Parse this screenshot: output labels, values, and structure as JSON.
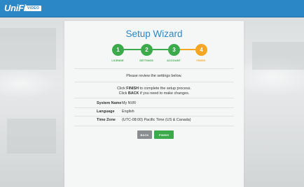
{
  "header": {
    "logo_text": "UniFi",
    "logo_badge": "VIDEO",
    "brand_color": "#2b87c6"
  },
  "wizard": {
    "title": "Setup Wizard",
    "steps": [
      {
        "number": "1",
        "label": "LICENSE",
        "state": "complete",
        "color": "#3aaa4a"
      },
      {
        "number": "2",
        "label": "SETTINGS",
        "state": "complete",
        "color": "#3aaa4a"
      },
      {
        "number": "3",
        "label": "ACCOUNT",
        "state": "complete",
        "color": "#3aaa4a"
      },
      {
        "number": "4",
        "label": "FINISH",
        "state": "current",
        "color": "#f5a623"
      }
    ],
    "review_text": "Please review the settings below.",
    "instruction_line1_pre": "Click ",
    "instruction_line1_bold": "FINISH",
    "instruction_line1_post": " to complete the setup process.",
    "instruction_line2_pre": "Click ",
    "instruction_line2_bold": "BACK",
    "instruction_line2_post": " if you need to make changes.",
    "settings": [
      {
        "label": "System Name",
        "value": "My NVR"
      },
      {
        "label": "Language",
        "value": "English"
      },
      {
        "label": "Time Zone",
        "value": "(UTC-08:00) Pacific Time (US & Canada)"
      }
    ],
    "back_label": "BACK",
    "finish_label": "FINISH",
    "back_color": "#8a8d8f",
    "finish_color": "#3aaa4a"
  }
}
